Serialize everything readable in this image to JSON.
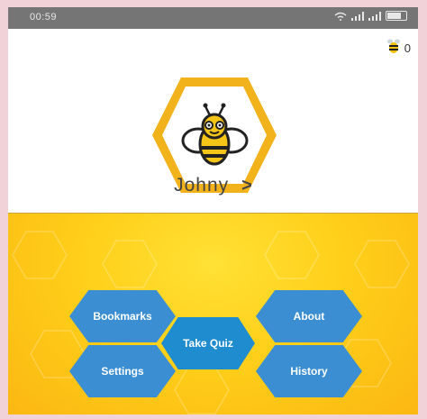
{
  "status_bar": {
    "time": "00:59"
  },
  "profile": {
    "coins": "0",
    "username": "Johny",
    "chevron": ">"
  },
  "menu": {
    "bookmarks": "Bookmarks",
    "about": "About",
    "take_quiz": "Take Quiz",
    "settings": "Settings",
    "history": "History"
  },
  "colors": {
    "hex_button": "#3c8ed3",
    "background_top": "#ffffff",
    "background_bottom": "#ffcf1a",
    "logo_border": "#f2b21b"
  },
  "icons": {
    "coins": "bee-coin-icon",
    "logo": "bee-logo-icon",
    "signal": "signal-icon",
    "battery": "battery-icon"
  }
}
